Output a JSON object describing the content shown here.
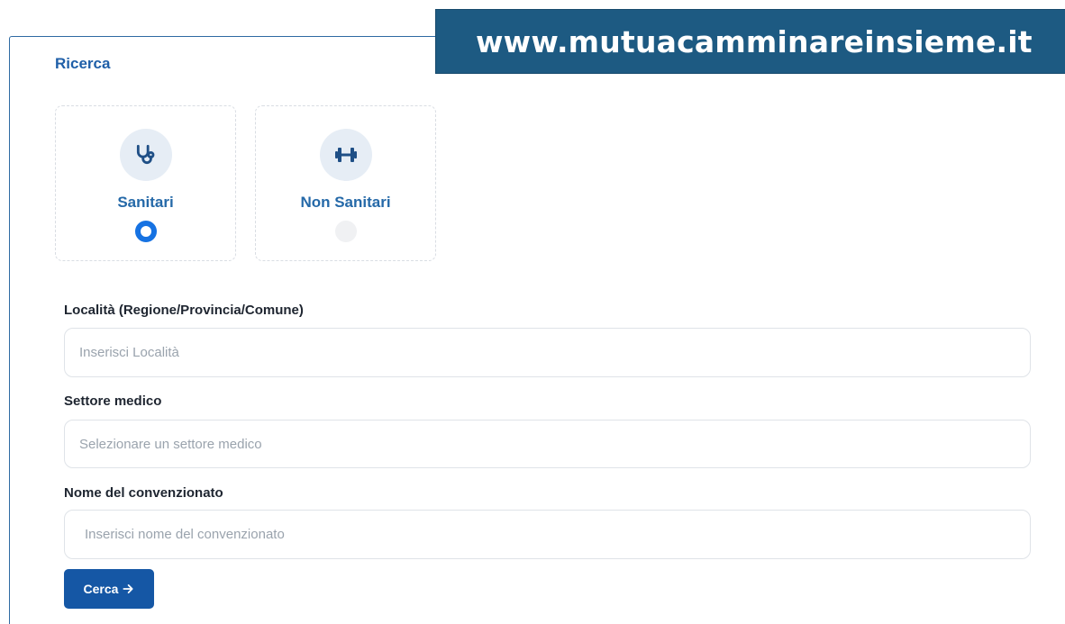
{
  "banner": {
    "url": "www.mutuacamminareinsieme.it"
  },
  "search": {
    "title": "Ricerca",
    "categories": [
      {
        "label": "Sanitari",
        "icon": "stethoscope-icon",
        "selected": true
      },
      {
        "label": "Non Sanitari",
        "icon": "dumbbell-icon",
        "selected": false
      }
    ],
    "location": {
      "label": "Località (Regione/Provincia/Comune)",
      "placeholder": "Inserisci Località",
      "value": ""
    },
    "sector": {
      "label": "Settore medico",
      "placeholder": "Selezionare un settore medico"
    },
    "provider": {
      "label": "Nome del convenzionato",
      "placeholder": "Inserisci nome del convenzionato",
      "value": ""
    },
    "button": {
      "label": "Cerca",
      "icon": "arrow-right-icon"
    }
  },
  "colors": {
    "accent": "#1f5fa8",
    "button": "#1557a5",
    "radio_selected": "#1672e2",
    "banner": "#1d5a82"
  }
}
